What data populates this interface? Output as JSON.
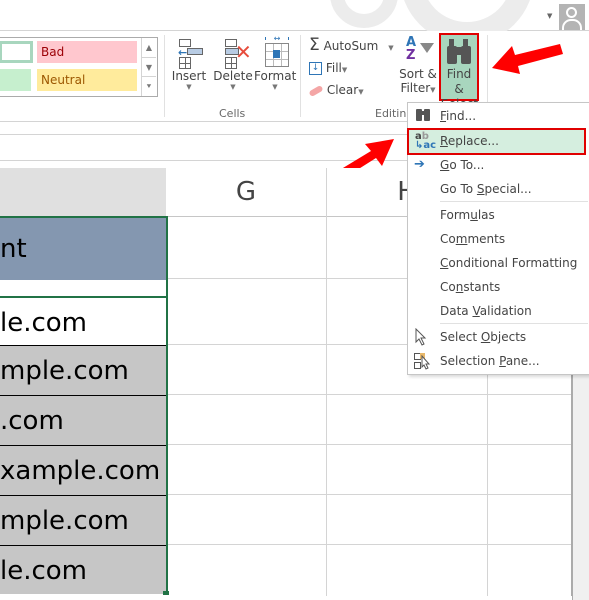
{
  "colors": {
    "highlight_red": "#e00000",
    "menu_highlight": "#d5eedf",
    "find_select_bg": "#a8d6be",
    "header_cell_bg": "#8497b0",
    "data_cell_bg": "#c6c6c6",
    "bad_bg": "#ffc7ce",
    "bad_fg": "#9c0006",
    "neutral_bg": "#ffeb9c",
    "neutral_fg": "#9c5700",
    "good_bg": "#c6efce"
  },
  "ribbon": {
    "styles": {
      "bad": "Bad",
      "neutral": "Neutral"
    },
    "cells_group": {
      "label": "Cells",
      "insert": "Insert",
      "delete": "Delete",
      "format": "Format"
    },
    "editing_group": {
      "label": "Editing",
      "autosum": "AutoSum",
      "fill": "Fill",
      "clear": "Clear",
      "sort_filter_line1": "Sort &",
      "sort_filter_line2": "Filter",
      "find_select_line1": "Find &",
      "find_select_line2": "Select"
    }
  },
  "grid": {
    "columns": [
      "G",
      "H"
    ],
    "header_cell_text": "nt",
    "data_cells": [
      "le.com",
      "mple.com",
      ".com",
      "xample.com",
      "mple.com",
      "le.com"
    ]
  },
  "find_select_menu": {
    "items": [
      {
        "pre": "",
        "u": "F",
        "post": "ind...",
        "icon": "binoculars-icon"
      },
      {
        "pre": "",
        "u": "R",
        "post": "eplace...",
        "icon": "replace-icon"
      },
      {
        "pre": "",
        "u": "G",
        "post": "o To...",
        "icon": "arrow-right-icon"
      },
      {
        "pre": "Go To ",
        "u": "S",
        "post": "pecial...",
        "icon": ""
      },
      {
        "pre": "Form",
        "u": "u",
        "post": "las",
        "icon": ""
      },
      {
        "pre": "Co",
        "u": "m",
        "post": "ments",
        "icon": ""
      },
      {
        "pre": "",
        "u": "C",
        "post": "onditional Formatting",
        "icon": ""
      },
      {
        "pre": "Co",
        "u": "n",
        "post": "stants",
        "icon": ""
      },
      {
        "pre": "Data ",
        "u": "V",
        "post": "alidation",
        "icon": ""
      },
      {
        "pre": "Select ",
        "u": "O",
        "post": "bjects",
        "icon": "pointer-icon"
      },
      {
        "pre": "Selection ",
        "u": "P",
        "post": "ane...",
        "icon": "selection-pane-icon"
      }
    ]
  }
}
